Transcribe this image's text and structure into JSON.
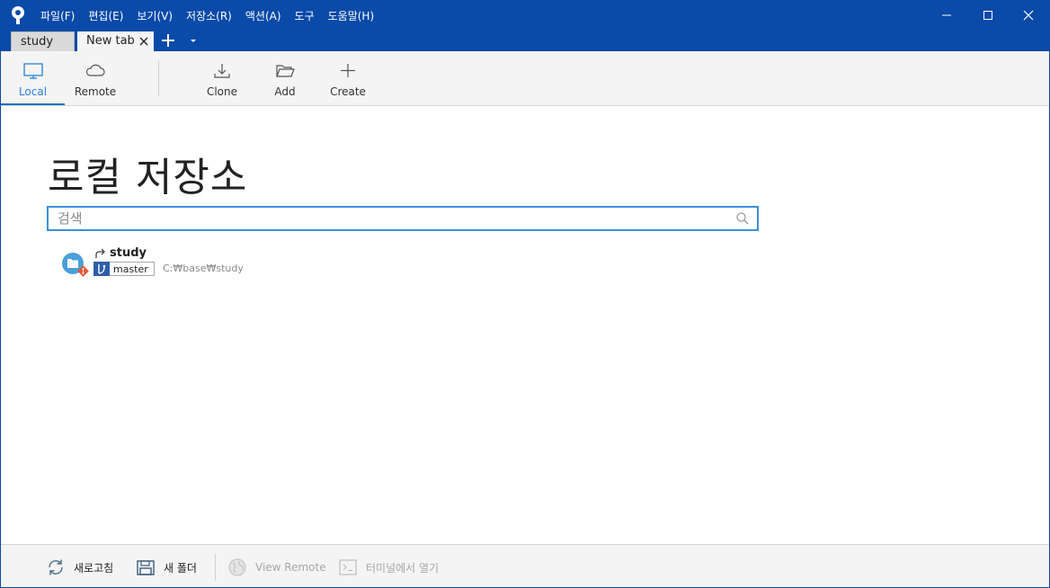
{
  "titlebar": {
    "menu": [
      "파일(F)",
      "편집(E)",
      "보기(V)",
      "저장소(R)",
      "액션(A)",
      "도구",
      "도움말(H)"
    ]
  },
  "tabs": [
    {
      "label": "study",
      "active": false
    },
    {
      "label": "New tab",
      "active": true
    }
  ],
  "toolbar": {
    "local": "Local",
    "remote": "Remote",
    "clone": "Clone",
    "add": "Add",
    "create": "Create"
  },
  "main": {
    "title": "로컬 저장소",
    "search_placeholder": "검색",
    "repos": [
      {
        "name": "study",
        "branch": "master",
        "path": "C:₩base₩study"
      }
    ]
  },
  "bottombar": {
    "refresh": "새로고침",
    "new_folder": "새 폴더",
    "view_remote": "View Remote",
    "open_terminal": "터미널에서 열기"
  },
  "colors": {
    "titlebar": "#0a4aa8",
    "accent": "#2a7fd4",
    "search_border": "#3c8fd8"
  }
}
